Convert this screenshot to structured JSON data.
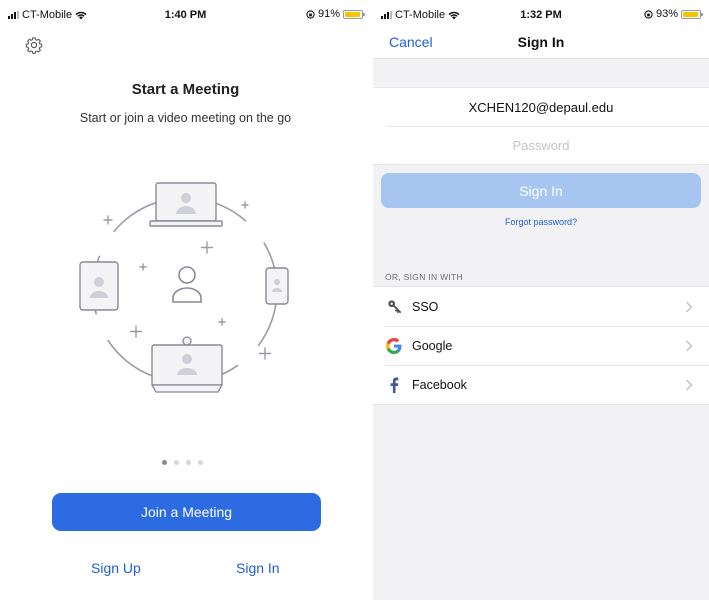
{
  "left": {
    "status": {
      "carrier": "CT-Mobile",
      "time": "1:40 PM",
      "battery": "91%"
    },
    "title": "Start a Meeting",
    "subtitle": "Start or join a video meeting on the go",
    "pager": {
      "count": 4,
      "active": 0
    },
    "join_label": "Join a Meeting",
    "signup_label": "Sign Up",
    "signin_label": "Sign In"
  },
  "right": {
    "status": {
      "carrier": "CT-Mobile",
      "time": "1:32 PM",
      "battery": "93%"
    },
    "cancel_label": "Cancel",
    "title": "Sign In",
    "email_value": "XCHEN120@depaul.edu",
    "password_placeholder": "Password",
    "signin_label": "Sign In",
    "forgot_label": "Forgot password?",
    "or_label": "OR, SIGN IN WITH",
    "providers": [
      {
        "label": "SSO",
        "icon": "key-icon"
      },
      {
        "label": "Google",
        "icon": "google-icon"
      },
      {
        "label": "Facebook",
        "icon": "facebook-icon"
      }
    ]
  },
  "colors": {
    "primary_blue": "#2d6be3",
    "link_blue": "#1e5fd8",
    "disabled_blue": "#a6c6f1",
    "battery_yellow": "#f2c500",
    "grouped_bg": "#f2f2f4"
  }
}
